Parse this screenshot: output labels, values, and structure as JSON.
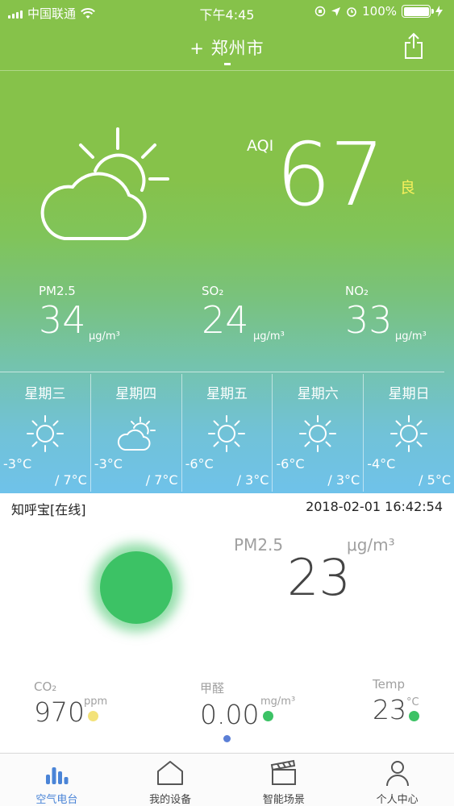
{
  "status_bar": {
    "carrier": "中国联通",
    "time": "下午4:45",
    "battery": "100%"
  },
  "header": {
    "city": "+ 郑州市"
  },
  "aqi": {
    "label": "AQI",
    "value": "67",
    "level": "良",
    "level_color": "#f6ef5b",
    "weather_icon": "partly-cloudy-icon"
  },
  "pollutants": [
    {
      "label": "PM2.5",
      "value": "34",
      "unit": "μg/m³"
    },
    {
      "label": "SO₂",
      "value": "24",
      "unit": "μg/m³"
    },
    {
      "label": "NO₂",
      "value": "33",
      "unit": "μg/m³"
    }
  ],
  "forecast": [
    {
      "day": "星期三",
      "icon": "sun-icon",
      "low": "-3°C",
      "high": "/ 7°C"
    },
    {
      "day": "星期四",
      "icon": "partly-cloudy-icon",
      "low": "-3°C",
      "high": "/ 7°C"
    },
    {
      "day": "星期五",
      "icon": "sun-icon",
      "low": "-6°C",
      "high": "/ 3°C"
    },
    {
      "day": "星期六",
      "icon": "sun-icon",
      "low": "-6°C",
      "high": "/ 3°C"
    },
    {
      "day": "星期日",
      "icon": "sun-icon",
      "low": "-4°C",
      "high": "/ 5°C"
    }
  ],
  "device": {
    "name": "知呼宝[在线]",
    "timestamp": "2018-02-01 16:42:54",
    "pm25_label": "PM2.5",
    "pm25_unit": "μg/m³",
    "pm25_value": "23",
    "status_color": "#3cc265"
  },
  "metrics": [
    {
      "label": "CO₂",
      "value": "970",
      "unit": "ppm",
      "dot_color": "#f3e27a"
    },
    {
      "label": "甲醛",
      "value": "0.00",
      "unit": "mg/m³",
      "dot_color": "#3cc265"
    },
    {
      "label": "Temp",
      "value": "23",
      "unit": "°C",
      "dot_color": "#3cc265"
    }
  ],
  "tabs": [
    {
      "label": "空气电台",
      "icon": "bar-chart-icon",
      "active": true
    },
    {
      "label": "我的设备",
      "icon": "home-icon",
      "active": false
    },
    {
      "label": "智能场景",
      "icon": "clapperboard-icon",
      "active": false
    },
    {
      "label": "个人中心",
      "icon": "person-icon",
      "active": false
    }
  ],
  "colors": {
    "accent": "#4a84d7",
    "header_green": "#86c24a",
    "header_blue": "#6fc2ea"
  }
}
